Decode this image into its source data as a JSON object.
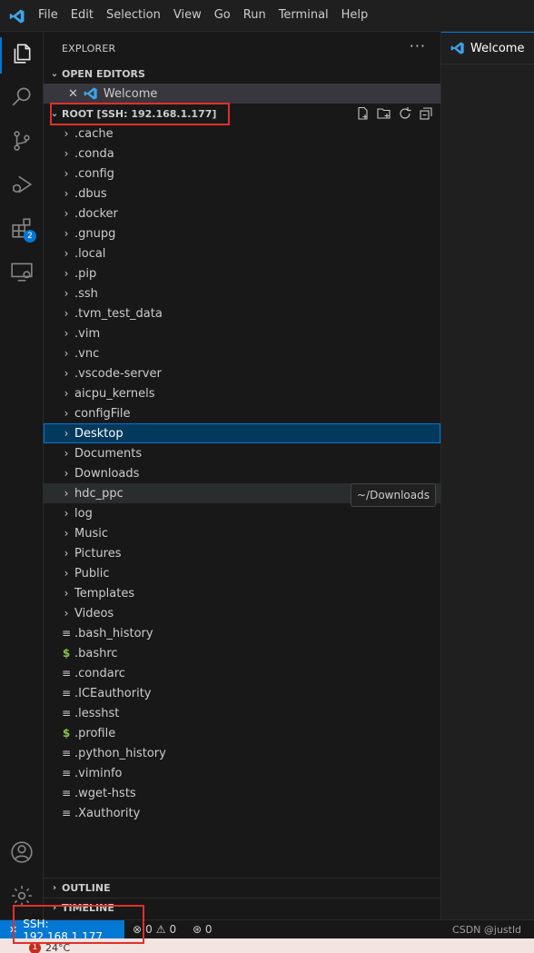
{
  "window": {
    "menu": [
      "File",
      "Edit",
      "Selection",
      "View",
      "Go",
      "Run",
      "Terminal",
      "Help"
    ]
  },
  "activity_bar": {
    "items": [
      "explorer-icon",
      "search-icon",
      "source-control-icon",
      "run-debug-icon",
      "extensions-icon",
      "remote-explorer-icon"
    ],
    "extensions_badge": "2",
    "bottom": [
      "accounts-icon",
      "manage-gear-icon"
    ]
  },
  "sidebar": {
    "title": "EXPLORER",
    "more": "···",
    "open_editors": {
      "label": "OPEN EDITORS",
      "items": [
        {
          "close": "✕",
          "name": "Welcome"
        }
      ]
    },
    "root": {
      "label": "ROOT [SSH: 192.168.1.177]",
      "actions": [
        "new-file-icon",
        "new-folder-icon",
        "refresh-icon",
        "collapse-all-icon"
      ]
    },
    "tree": [
      {
        "type": "folder",
        "name": ".cache"
      },
      {
        "type": "folder",
        "name": ".conda"
      },
      {
        "type": "folder",
        "name": ".config"
      },
      {
        "type": "folder",
        "name": ".dbus"
      },
      {
        "type": "folder",
        "name": ".docker"
      },
      {
        "type": "folder",
        "name": ".gnupg"
      },
      {
        "type": "folder",
        "name": ".local"
      },
      {
        "type": "folder",
        "name": ".pip"
      },
      {
        "type": "folder",
        "name": ".ssh"
      },
      {
        "type": "folder",
        "name": ".tvm_test_data"
      },
      {
        "type": "folder",
        "name": ".vim"
      },
      {
        "type": "folder",
        "name": ".vnc"
      },
      {
        "type": "folder",
        "name": ".vscode-server"
      },
      {
        "type": "folder",
        "name": "aicpu_kernels"
      },
      {
        "type": "folder",
        "name": "configFile"
      },
      {
        "type": "folder",
        "name": "Desktop",
        "state": "selected"
      },
      {
        "type": "folder",
        "name": "Documents"
      },
      {
        "type": "folder",
        "name": "Downloads"
      },
      {
        "type": "folder",
        "name": "hdc_ppc",
        "state": "hover"
      },
      {
        "type": "folder",
        "name": "log"
      },
      {
        "type": "folder",
        "name": "Music"
      },
      {
        "type": "folder",
        "name": "Pictures"
      },
      {
        "type": "folder",
        "name": "Public"
      },
      {
        "type": "folder",
        "name": "Templates"
      },
      {
        "type": "folder",
        "name": "Videos"
      },
      {
        "type": "file",
        "name": ".bash_history"
      },
      {
        "type": "shell",
        "name": ".bashrc"
      },
      {
        "type": "file",
        "name": ".condarc"
      },
      {
        "type": "file",
        "name": ".ICEauthority"
      },
      {
        "type": "file",
        "name": ".lesshst"
      },
      {
        "type": "shell",
        "name": ".profile"
      },
      {
        "type": "file",
        "name": ".python_history"
      },
      {
        "type": "file",
        "name": ".viminfo"
      },
      {
        "type": "file",
        "name": ".wget-hsts"
      },
      {
        "type": "file",
        "name": ".Xauthority"
      }
    ],
    "tooltip": "~/Downloads",
    "outline_label": "OUTLINE",
    "timeline_label": "TIMELINE"
  },
  "editor": {
    "tabs": [
      {
        "label": "Welcome"
      }
    ]
  },
  "status_bar": {
    "remote": "SSH: 192.168.1.177",
    "errors": "0",
    "warnings": "0",
    "ports": "0",
    "watermark": "CSDN @justld"
  },
  "taskbar": {
    "badge": "1",
    "temperature": "24°C"
  },
  "colors": {
    "accent": "#0078d4",
    "annotation": "#e0312b",
    "shell_icon": "#8dc149"
  }
}
